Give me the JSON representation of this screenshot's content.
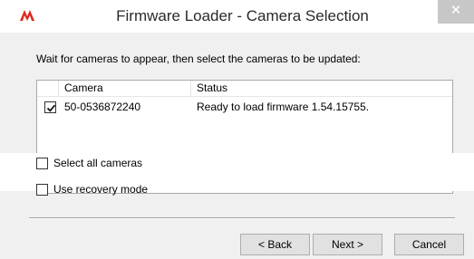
{
  "window": {
    "title": "Firmware Loader - Camera Selection",
    "close_glyph": "✕",
    "app_icon": "flir-logo-icon",
    "accent_color": "#e0261b"
  },
  "main": {
    "instruction": "Wait for cameras to appear, then select the cameras to be updated:"
  },
  "camera_list": {
    "columns": [
      "",
      "Camera",
      "Status"
    ],
    "rows": [
      {
        "checked": true,
        "camera": "50-0536872240",
        "status": "Ready to load firmware 1.54.15755."
      }
    ]
  },
  "options": {
    "select_all": {
      "label": "Select all cameras",
      "checked": false
    },
    "recovery": {
      "label": "Use recovery mode",
      "checked": false
    }
  },
  "buttons": {
    "back": "< Back",
    "next": "Next >",
    "cancel": "Cancel"
  }
}
